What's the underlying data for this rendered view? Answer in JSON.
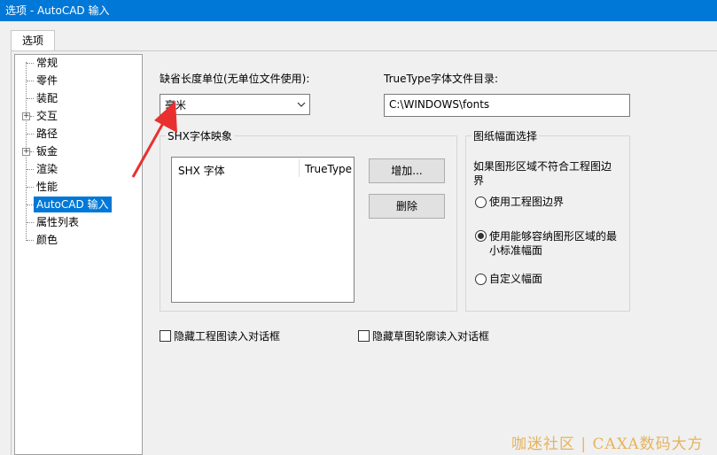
{
  "window": {
    "title": "选项 - AutoCAD 输入"
  },
  "tabs": [
    {
      "label": "选项"
    }
  ],
  "tree": {
    "items": [
      {
        "label": "常规",
        "expandable": false
      },
      {
        "label": "零件",
        "expandable": false
      },
      {
        "label": "装配",
        "expandable": false
      },
      {
        "label": "交互",
        "expandable": true
      },
      {
        "label": "路径",
        "expandable": false
      },
      {
        "label": "钣金",
        "expandable": true
      },
      {
        "label": "渲染",
        "expandable": false
      },
      {
        "label": "性能",
        "expandable": false
      },
      {
        "label": "AutoCAD 输入",
        "expandable": false,
        "selected": true
      },
      {
        "label": "属性列表",
        "expandable": false
      },
      {
        "label": "颜色",
        "expandable": false
      }
    ]
  },
  "length_unit": {
    "label": "缺省长度单位(无单位文件使用):",
    "value": "毫米"
  },
  "truetype_dir": {
    "label": "TrueType字体文件目录:",
    "value": "C:\\WINDOWS\\fonts"
  },
  "shx_mapping": {
    "title": "SHX字体映象",
    "columns": [
      "SHX 字体",
      "TrueType"
    ],
    "add_label": "增加...",
    "delete_label": "删除"
  },
  "paper_size": {
    "title": "图纸幅面选择",
    "prompt": "如果图形区域不符合工程图边界",
    "options": [
      {
        "label": "使用工程图边界",
        "selected": false
      },
      {
        "label": "使用能够容纳图形区域的最小标准幅面",
        "selected": true
      },
      {
        "label": "自定义幅面",
        "selected": false
      }
    ]
  },
  "checkboxes": [
    {
      "label": "隐藏工程图读入对话框",
      "checked": false
    },
    {
      "label": "隐藏草图轮廓读入对话框",
      "checked": false
    }
  ],
  "watermark": "咖迷社区 | CAXA数码大方",
  "colors": {
    "accent": "#0078d7",
    "annotation_arrow": "#e8312f",
    "watermark": "#e6b35b"
  }
}
